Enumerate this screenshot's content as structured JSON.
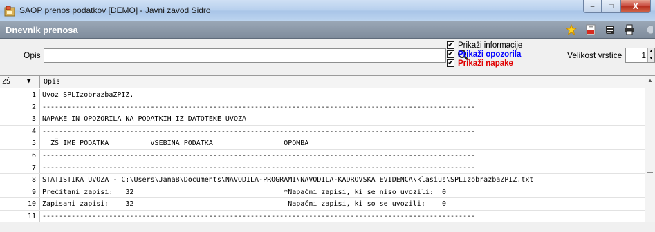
{
  "window": {
    "title": "SAOP prenos podatkov [DEMO] - Javni zavod Sidro",
    "controls": {
      "minimize": "–",
      "maximize": "□",
      "close": "X"
    }
  },
  "module": {
    "title": "Dnevnik prenosa",
    "toolbar_icons": [
      "star-icon",
      "pdf-icon",
      "export-icon",
      "print-icon",
      "help-icon"
    ]
  },
  "filter": {
    "opis_label": "Opis",
    "opis_value": "",
    "checkboxes": [
      {
        "label": "Prikaži informacije",
        "checked": true,
        "mark": "✔",
        "color": "#000000"
      },
      {
        "label": "Prikaži opozorila",
        "checked": true,
        "mark": "✔",
        "color": "#0000ff"
      },
      {
        "label": "Prikaži napake",
        "checked": true,
        "mark": "✔",
        "color": "#e00000"
      }
    ],
    "row_size_label": "Velikost vrstice",
    "row_size_value": "1"
  },
  "grid": {
    "columns": {
      "number": "ZŠ",
      "sort_indicator": "▼",
      "description": "Opis"
    },
    "rows": [
      {
        "n": "1",
        "text": "Uvoz SPLIzobrazbaZPIZ."
      },
      {
        "n": "2",
        "text": "--------------------------------------------------------------------------------------------------------"
      },
      {
        "n": "3",
        "text": "NAPAKE IN OPOZORILA NA PODATKIH IZ DATOTEKE UVOZA"
      },
      {
        "n": "4",
        "text": "--------------------------------------------------------------------------------------------------------"
      },
      {
        "n": "5",
        "text": "  ZŠ IME PODATKA          VSEBINA PODATKA                 OPOMBA"
      },
      {
        "n": "6",
        "text": "--------------------------------------------------------------------------------------------------------"
      },
      {
        "n": "7",
        "text": "--------------------------------------------------------------------------------------------------------"
      },
      {
        "n": "8",
        "text": "STATISTIKA UVOZA - C:\\Users\\JanaB\\Documents\\NAVODILA-PROGRAMI\\NAVODILA-KADROVSKA EVIDENCA\\klasius\\SPLIzobrazbaZPIZ.txt"
      },
      {
        "n": "9",
        "text": "Prečitani zapisi:   32                                    *Napačni zapisi, ki se niso uvozili:  0"
      },
      {
        "n": "10",
        "text": "Zapisani zapisi:    32                                     Napačni zapisi, ki so se uvozili:    0"
      },
      {
        "n": "11",
        "text": "--------------------------------------------------------------------------------------------------------"
      }
    ]
  }
}
